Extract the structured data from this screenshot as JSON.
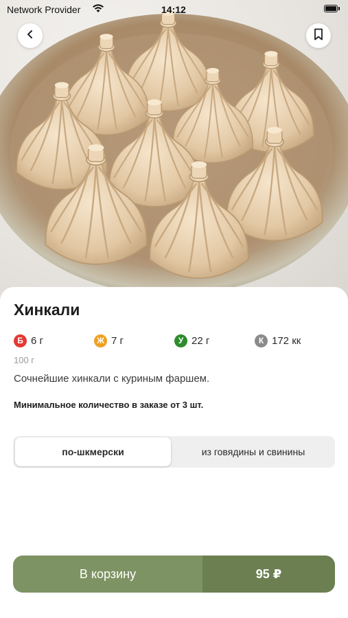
{
  "status_bar": {
    "carrier": "Network Provider",
    "time": "14:12"
  },
  "product": {
    "title": "Хинкали",
    "nutrients": [
      {
        "letter": "Б",
        "value": "6 г",
        "color": "#e53935"
      },
      {
        "letter": "Ж",
        "value": "7 г",
        "color": "#f0a020"
      },
      {
        "letter": "У",
        "value": "22 г",
        "color": "#2e8b2e"
      },
      {
        "letter": "К",
        "value": "172 кк",
        "color": "#8a8a8a"
      }
    ],
    "weight": "100 г",
    "description": "Сочнейшие хинкали с куриным фаршем.",
    "min_order": "Минимальное количество в заказе от 3 шт."
  },
  "variants": {
    "options": [
      "по-шкмерски",
      "из говядины и свинины"
    ],
    "selected": "по-шкмерски"
  },
  "cart": {
    "label": "В корзину",
    "price": "95 ₽"
  },
  "colors": {
    "accent": "#7e9363",
    "accent_dark": "#6b7f51"
  },
  "icons": {
    "back": "chevron-left-icon",
    "bookmark": "bookmark-icon"
  }
}
